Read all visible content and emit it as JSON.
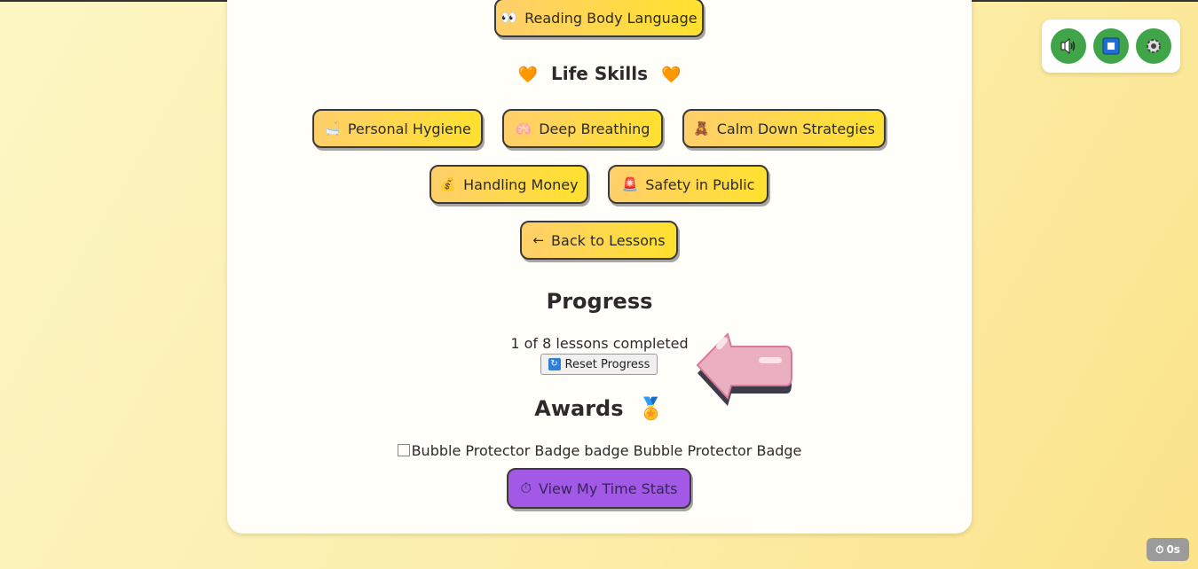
{
  "top_button": {
    "icon": "👀",
    "label": "Reading Body Language"
  },
  "life_skills": {
    "heading": "Life Skills",
    "heart_icon": "🧡",
    "buttons": [
      {
        "icon": "🛁",
        "label": "Personal Hygiene"
      },
      {
        "icon": "🫁",
        "label": "Deep Breathing"
      },
      {
        "icon": "🧸",
        "label": "Calm Down Strategies"
      },
      {
        "icon": "💰",
        "label": "Handling Money"
      },
      {
        "icon": "🚨",
        "label": "Safety in Public"
      }
    ],
    "back_button": {
      "icon": "←",
      "label": "Back to Lessons"
    }
  },
  "progress": {
    "heading": "Progress",
    "status_text": "1 of 8 lessons completed",
    "reset_icon": "🔄",
    "reset_label": "Reset Progress"
  },
  "awards": {
    "heading": "Awards",
    "medal_icon": "🏅",
    "badge_text": "Bubble Protector Badge badge Bubble Protector Badge"
  },
  "time_stats_button": {
    "icon": "⏱",
    "label": "View My Time Stats"
  },
  "controls": [
    {
      "name": "sound",
      "icon": "speaker-icon"
    },
    {
      "name": "stop",
      "icon": "stop-icon"
    },
    {
      "name": "settings",
      "icon": "gear-icon"
    }
  ],
  "timer": {
    "icon": "⏱",
    "value": "0s"
  },
  "colors": {
    "accent_yellow": "#ffe12e",
    "accent_orange": "#ffcf6b",
    "purple": "#a259e6",
    "control_green": "#3fa548",
    "arrow_pink": "#eab0c0"
  }
}
